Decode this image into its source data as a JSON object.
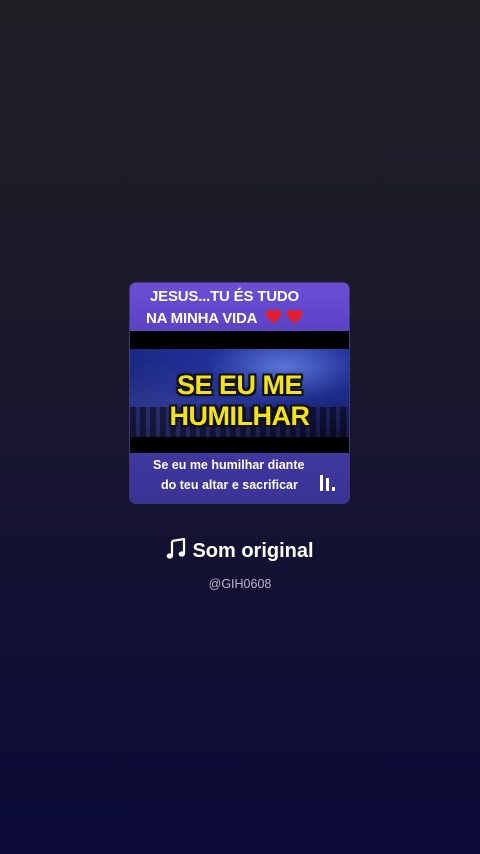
{
  "card": {
    "header_line1": "JESUS...TU ÉS TUDO",
    "header_line2": "NA MINHA VIDA",
    "video_title_line1": "SE EU ME",
    "video_title_line2": "HUMILHAR",
    "lyrics_line1": "Se eu me humilhar diante",
    "lyrics_line2": "do teu altar e sacrificar"
  },
  "sound": {
    "icon": "music-note-icon",
    "title": "Som original",
    "handle": "@GIH0608"
  },
  "colors": {
    "header_purple": "#5b43c4",
    "title_yellow": "#f4e21a",
    "heart_red": "#e02030"
  }
}
